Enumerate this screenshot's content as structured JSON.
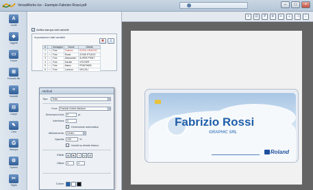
{
  "titlebar": {
    "title": "VersaWorks Ice - Esempio Fabrizio Rossi.pdf"
  },
  "toolbar": {
    "icons": [
      "zoom-in-icon",
      "fit-page-icon",
      "grid-icon",
      "ruler-icon",
      "align-left-icon",
      "align-center-icon",
      "align-right-icon",
      "zoom-out-icon"
    ]
  },
  "rail": {
    "items": [
      {
        "label": "Livelli",
        "glyph": "A"
      },
      {
        "label": "Oggetti",
        "glyph": "◆"
      },
      {
        "label": "Forme",
        "glyph": "▭"
      },
      {
        "label": "Formato file",
        "glyph": "⊞"
      },
      {
        "label": "Variabili",
        "glyph": "≡"
      },
      {
        "label": "Campi",
        "glyph": "⊟"
      },
      {
        "label": "Crea",
        "glyph": "✎"
      },
      {
        "label": "Stampa",
        "glyph": "⎙"
      },
      {
        "label": "Opzioni",
        "glyph": "⚙"
      },
      {
        "label": "Taglia",
        "glyph": "✂"
      }
    ]
  },
  "panel": {
    "enable_label": "Abilita stampa dati variabili",
    "group_title": "Impostazioni dati variabili",
    "table_headers": [
      "#",
      "",
      "Immagine",
      "Nome",
      "Cliente"
    ],
    "rows": [
      {
        "n": "1",
        "img": "Foto",
        "name": "Fabrizio",
        "client": "ROSSI GRAPHIC"
      },
      {
        "n": "2",
        "img": "Foto",
        "name": "Rossi",
        "client": "ZOOM STUDIO"
      },
      {
        "n": "3",
        "img": "Foto",
        "name": "Alessandro",
        "client": "SUPER PRINT"
      },
      {
        "n": "4",
        "img": "Foto",
        "name": "Davide",
        "client": "STICKER"
      },
      {
        "n": "5",
        "img": "Foto",
        "name": "Marco",
        "client": "PRINTWEB"
      },
      {
        "n": "6",
        "img": "Foto",
        "name": "Lorenzo",
        "client": "VEICOLI"
      }
    ]
  },
  "attributes": {
    "title": "Attributi",
    "tipo_label": "Tipo:",
    "tipo_value": "Testo",
    "font_label": "Font:",
    "font_value": "Franklin Gothic Medium",
    "size_label": "Dimensioni font:",
    "size_value": "9",
    "size_unit": "pt",
    "spacing_label": "Interlinea:",
    "spacing_value": "0",
    "auto_label": "Dimensione automatica",
    "align_label": "Allineamento:",
    "align_value": "Centro",
    "opacity_label": "Opacità:",
    "opacity_value": "100",
    "opacity_unit": "%",
    "include_label": "Includi su ritratto bianco",
    "effects_label": "Effetti:",
    "effects": [
      "A",
      "B",
      "I",
      "U",
      "O"
    ],
    "offset_label": "Offset:",
    "offset_value": "4",
    "offset2_value": "4",
    "color_label": "Colore:"
  },
  "card": {
    "name": "Fabrizio Rossi",
    "company": "GRAPHIC SRL",
    "logo": "Roland"
  },
  "colors": {
    "accent": "#1f5fa8",
    "canvas": "#646464"
  }
}
